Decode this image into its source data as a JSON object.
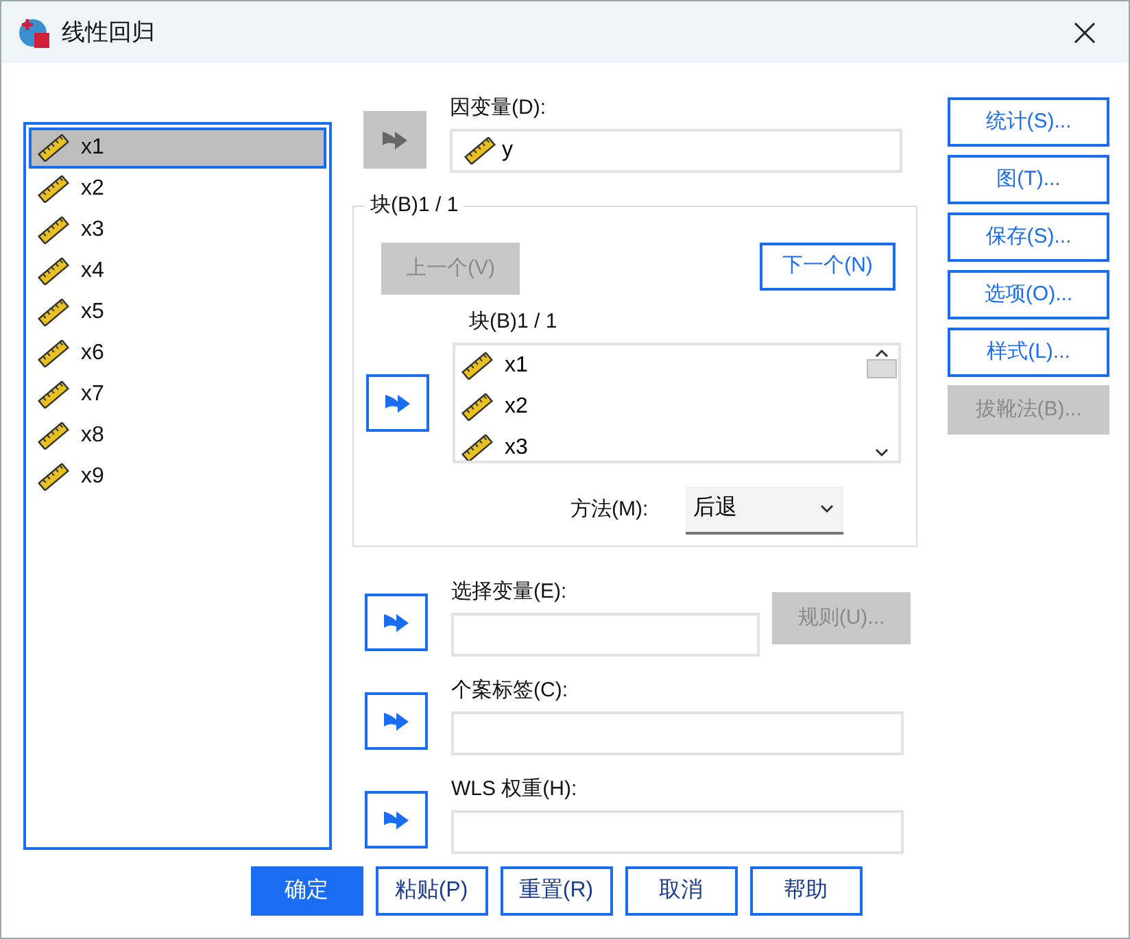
{
  "window": {
    "title": "线性回归"
  },
  "variables": [
    {
      "name": "x1",
      "selected": true
    },
    {
      "name": "x2",
      "selected": false
    },
    {
      "name": "x3",
      "selected": false
    },
    {
      "name": "x4",
      "selected": false
    },
    {
      "name": "x5",
      "selected": false
    },
    {
      "name": "x6",
      "selected": false
    },
    {
      "name": "x7",
      "selected": false
    },
    {
      "name": "x8",
      "selected": false
    },
    {
      "name": "x9",
      "selected": false
    }
  ],
  "dependent": {
    "label": "因变量(D):",
    "arrow_disabled": true,
    "value": "y"
  },
  "block": {
    "title": "块(B)1 / 1",
    "prev": {
      "label": "上一个(V)",
      "disabled": true
    },
    "next": {
      "label": "下一个(N)",
      "disabled": false
    },
    "list_label": "块(B)1 / 1",
    "arrow_disabled": false,
    "independents": [
      "x1",
      "x2",
      "x3"
    ],
    "method_label": "方法(M):",
    "method": "后退"
  },
  "selection": {
    "label": "选择变量(E):",
    "arrow_disabled": false,
    "rule": {
      "label": "规则(U)...",
      "disabled": true
    }
  },
  "case_labels": {
    "label": "个案标签(C):",
    "arrow_disabled": false
  },
  "wls": {
    "label": "WLS 权重(H):",
    "arrow_disabled": false
  },
  "side_buttons": [
    {
      "label": "统计(S)...",
      "disabled": false
    },
    {
      "label": "图(T)...",
      "disabled": false
    },
    {
      "label": "保存(S)...",
      "disabled": false
    },
    {
      "label": "选项(O)...",
      "disabled": false
    },
    {
      "label": "样式(L)...",
      "disabled": false
    },
    {
      "label": "拔靴法(B)...",
      "disabled": true
    }
  ],
  "buttons": [
    {
      "label": "确定",
      "default": true
    },
    {
      "label": "粘贴(P)",
      "default": false
    },
    {
      "label": "重置(R)",
      "default": false
    },
    {
      "label": "取消",
      "default": false
    },
    {
      "label": "帮助",
      "default": false
    }
  ]
}
